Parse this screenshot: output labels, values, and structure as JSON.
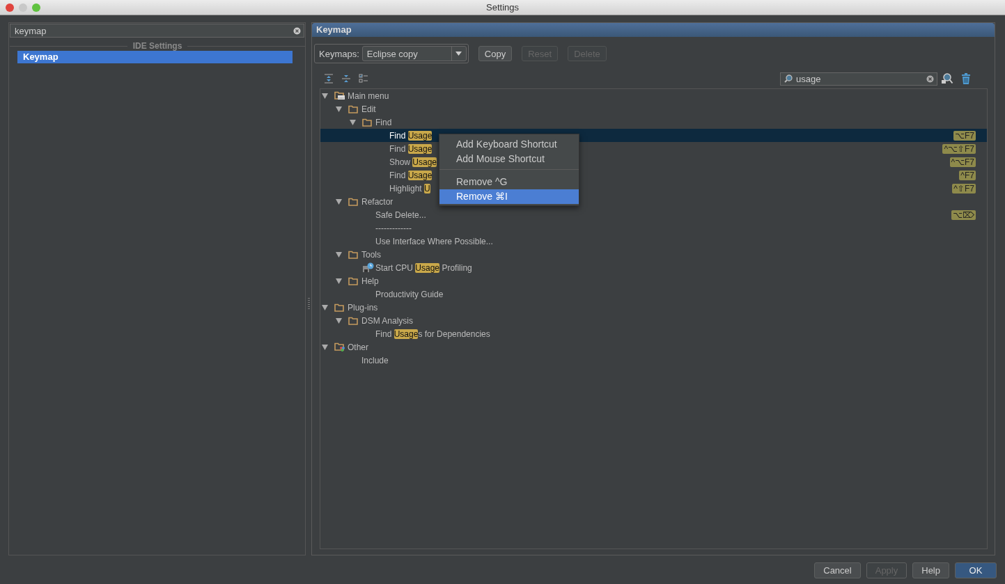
{
  "window": {
    "title": "Settings"
  },
  "sidebar": {
    "search": {
      "value": "keymap"
    },
    "section": "IDE Settings",
    "items": [
      {
        "label": "Keymap",
        "selected": true
      }
    ]
  },
  "panel": {
    "title": "Keymap",
    "keymaps": {
      "label": "Keymaps:",
      "value": "Eclipse copy"
    },
    "buttons": [
      {
        "label": "Copy",
        "disabled": false
      },
      {
        "label": "Reset",
        "disabled": true
      },
      {
        "label": "Delete",
        "disabled": true
      }
    ],
    "filter": {
      "value": "usage"
    },
    "tree": [
      {
        "kind": "main-menu",
        "label": "Main menu",
        "expanded": true,
        "children": [
          {
            "kind": "folder",
            "label": "Edit",
            "expanded": true,
            "children": [
              {
                "kind": "folder",
                "label": "Find",
                "expanded": true,
                "children": [
                  {
                    "kind": "action",
                    "label": "Find ",
                    "match": "Usage",
                    "selected": true,
                    "shortcut": "⌥F7"
                  },
                  {
                    "kind": "action",
                    "label": "Find ",
                    "match": "Usage",
                    "selected": false,
                    "shortcut": "^⌥⇧F7"
                  },
                  {
                    "kind": "action",
                    "label": "Show ",
                    "match": "Usage",
                    "selected": false,
                    "shortcut": "^⌥F7"
                  },
                  {
                    "kind": "action",
                    "label": "Find ",
                    "match": "Usage",
                    "selected": false,
                    "shortcut": "^F7"
                  },
                  {
                    "kind": "action",
                    "label": "Highlight ",
                    "match": "U",
                    "selected": false,
                    "shortcut": "^⇧F7"
                  }
                ]
              }
            ]
          },
          {
            "kind": "folder",
            "label": "Refactor",
            "expanded": true,
            "children": [
              {
                "kind": "action",
                "label": "Safe Delete...",
                "selected": false,
                "shortcut": "⌥⌦"
              },
              {
                "kind": "action",
                "label": "-------------",
                "selected": false
              },
              {
                "kind": "action",
                "label": "Use Interface Where Possible...",
                "selected": false
              }
            ]
          },
          {
            "kind": "folder",
            "label": "Tools",
            "expanded": true,
            "children": [
              {
                "kind": "profiler",
                "label": "Start CPU ",
                "match": "Usage",
                "after": " Profiling",
                "selected": false
              }
            ]
          },
          {
            "kind": "folder",
            "label": "Help",
            "expanded": true,
            "children": [
              {
                "kind": "action",
                "label": "Productivity Guide",
                "selected": false
              }
            ]
          }
        ]
      },
      {
        "kind": "folder",
        "label": "Plug-ins",
        "expanded": true,
        "children": [
          {
            "kind": "folder",
            "label": "DSM Analysis",
            "expanded": true,
            "children": [
              {
                "kind": "action",
                "label": "Find ",
                "match": "Usage",
                "after": "s for Dependencies",
                "selected": false
              }
            ]
          }
        ]
      },
      {
        "kind": "other",
        "label": "Other",
        "expanded": true,
        "children": [
          {
            "kind": "action",
            "label": "Include",
            "selected": false
          }
        ]
      }
    ],
    "context_menu": [
      [
        {
          "label": "Add Keyboard Shortcut",
          "selected": false
        },
        {
          "label": "Add Mouse Shortcut",
          "selected": false
        }
      ],
      [
        {
          "label": "Remove ^G",
          "selected": false
        },
        {
          "label": "Remove ⌘I",
          "selected": true
        }
      ]
    ]
  },
  "footer": {
    "buttons": [
      {
        "label": "Cancel",
        "disabled": false,
        "default": false
      },
      {
        "label": "Apply",
        "disabled": true,
        "default": false
      },
      {
        "label": "Help",
        "disabled": false,
        "default": false
      },
      {
        "label": "OK",
        "disabled": false,
        "default": true
      }
    ]
  }
}
